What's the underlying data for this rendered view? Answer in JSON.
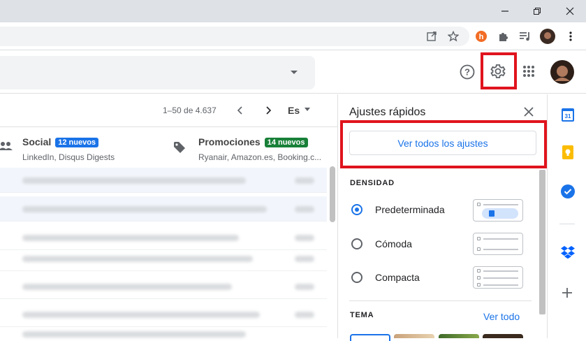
{
  "pagination": {
    "range": "1–50 de 4.637",
    "language": "Es"
  },
  "tabs": [
    {
      "title": "Social",
      "badge": "12 nuevos",
      "badge_color": "#1a73e8",
      "subtitle": "LinkedIn, Disqus Digests",
      "icon": "people-icon"
    },
    {
      "title": "Promociones",
      "badge": "14 nuevos",
      "badge_color": "#188038",
      "subtitle": "Ryanair, Amazon.es, Booking.c...",
      "icon": "tag-icon"
    }
  ],
  "quick_settings": {
    "title": "Ajustes rápidos",
    "see_all_button": "Ver todos los ajustes",
    "density_heading": "DENSIDAD",
    "density_options": [
      {
        "label": "Predeterminada",
        "selected": true
      },
      {
        "label": "Cómoda",
        "selected": false
      },
      {
        "label": "Compacta",
        "selected": false
      }
    ],
    "theme_heading": "TEMA",
    "theme_see_all": "Ver todo"
  },
  "colors": {
    "highlight_border": "#e0141e",
    "accent": "#1a73e8"
  }
}
